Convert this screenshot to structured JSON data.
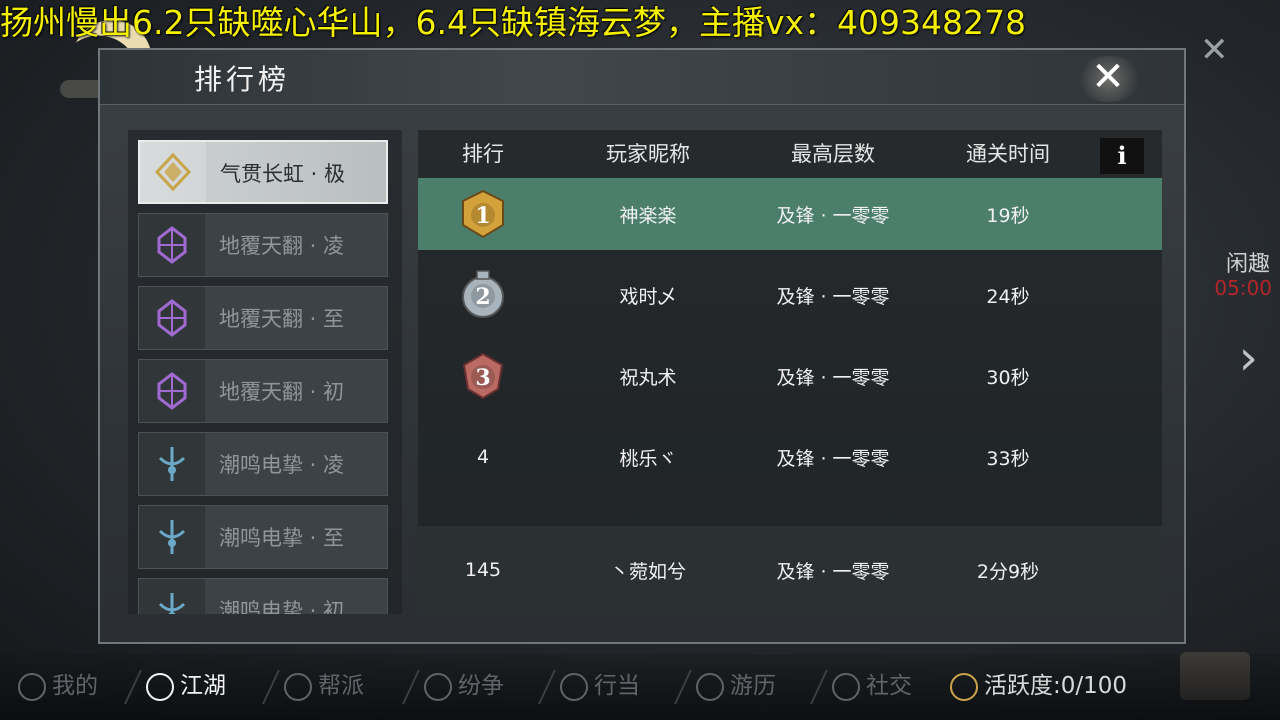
{
  "banner": {
    "text": "扬州慢出6.2只缺噬心华山，6.4只缺镇海云梦，主播vx：409348278"
  },
  "panel": {
    "title": "排行榜",
    "close_label": "✕"
  },
  "categories": [
    {
      "label": "气贯长虹 · 极",
      "icon": "diamond-emblem-icon",
      "color": "#c9a54a",
      "active": true
    },
    {
      "label": "地覆天翻 · 凌",
      "icon": "crystal-emblem-icon",
      "color": "#a06ad0",
      "active": false
    },
    {
      "label": "地覆天翻 · 至",
      "icon": "crystal-emblem-icon",
      "color": "#a06ad0",
      "active": false
    },
    {
      "label": "地覆天翻 · 初",
      "icon": "crystal-emblem-icon",
      "color": "#a06ad0",
      "active": false
    },
    {
      "label": "潮鸣电挚 · 凌",
      "icon": "spear-emblem-icon",
      "color": "#6aa9c8",
      "active": false
    },
    {
      "label": "潮鸣电挚 · 至",
      "icon": "spear-emblem-icon",
      "color": "#6aa9c8",
      "active": false
    },
    {
      "label": "潮鸣电挚 · 初",
      "icon": "spear-emblem-icon",
      "color": "#6aa9c8",
      "active": false
    }
  ],
  "table": {
    "headers": {
      "rank": "排行",
      "name": "玩家昵称",
      "floor": "最高层数",
      "time": "通关时间"
    },
    "info_label": "i",
    "rows": [
      {
        "rank": "1",
        "medal": "gold-medal-icon",
        "name": "神楽楽",
        "floor": "及锋 · 一零零",
        "time": "19秒"
      },
      {
        "rank": "2",
        "medal": "silver-medal-icon",
        "name": "戏时乄",
        "floor": "及锋 · 一零零",
        "time": "24秒"
      },
      {
        "rank": "3",
        "medal": "bronze-medal-icon",
        "name": "祝丸术",
        "floor": "及锋 · 一零零",
        "time": "30秒"
      },
      {
        "rank": "4",
        "medal": "",
        "name": "桃乐ヾ",
        "floor": "及锋 · 一零零",
        "time": "33秒"
      }
    ],
    "self_row": {
      "rank": "145",
      "name": "丶菀如兮",
      "floor": "及锋 · 一零零",
      "time": "2分9秒"
    }
  },
  "side": {
    "text": "闲趣",
    "timer": "05:00"
  },
  "bottom_nav": {
    "items": [
      {
        "label": "我的",
        "icon": "gear-icon",
        "active": false
      },
      {
        "label": "江湖",
        "icon": "scroll-icon",
        "active": true
      },
      {
        "label": "帮派",
        "icon": "guild-icon",
        "active": false
      },
      {
        "label": "纷争",
        "icon": "swords-icon",
        "active": false
      },
      {
        "label": "行当",
        "icon": "tools-icon",
        "active": false
      },
      {
        "label": "游历",
        "icon": "magnifier-icon",
        "active": false
      },
      {
        "label": "社交",
        "icon": "social-icon",
        "active": false
      }
    ],
    "activity": "活跃度:0/100"
  },
  "colors": {
    "highlight_row": "#4b7f6c",
    "banner": "#f4f000",
    "gold": "#d4a23a",
    "silver": "#a9b3bb",
    "bronze": "#b86a63"
  }
}
